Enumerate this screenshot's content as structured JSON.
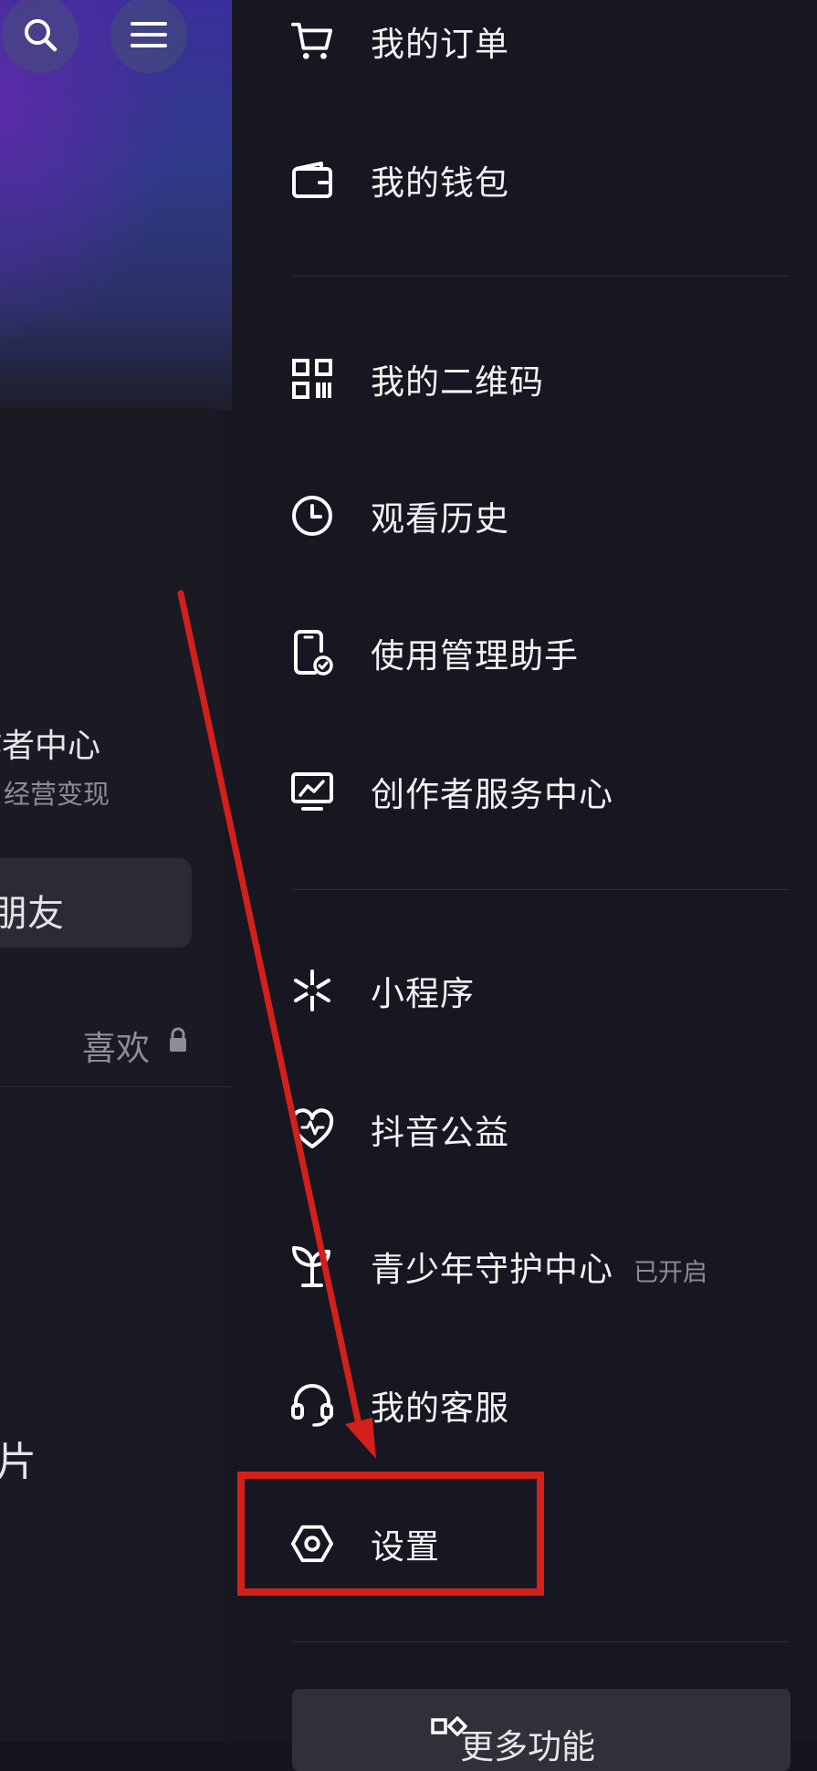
{
  "left": {
    "creator_title": "作者中心",
    "creator_subtitle": "经营变现",
    "friend_button_label": "朋友",
    "likes_tab_label": "喜欢",
    "tile_label": "片"
  },
  "menu": {
    "items": [
      {
        "label": "我的订单",
        "icon": "cart-icon"
      },
      {
        "label": "我的钱包",
        "icon": "wallet-icon"
      },
      {
        "label": "我的二维码",
        "icon": "qr-code-icon"
      },
      {
        "label": "观看历史",
        "icon": "clock-icon"
      },
      {
        "label": "使用管理助手",
        "icon": "phone-check-icon"
      },
      {
        "label": "创作者服务中心",
        "icon": "monitor-chart-icon"
      },
      {
        "label": "小程序",
        "icon": "mini-program-icon"
      },
      {
        "label": "抖音公益",
        "icon": "heart-charity-icon"
      },
      {
        "label": "青少年守护中心",
        "icon": "sprout-icon",
        "badge": "已开启"
      },
      {
        "label": "我的客服",
        "icon": "headset-icon"
      },
      {
        "label": "设置",
        "icon": "settings-hexagon-icon"
      }
    ],
    "more_label": "更多功能"
  },
  "colors": {
    "background": "#161720",
    "text": "#f2f3f5",
    "annotation": "#d3201a",
    "badge": "#8b8c94"
  }
}
